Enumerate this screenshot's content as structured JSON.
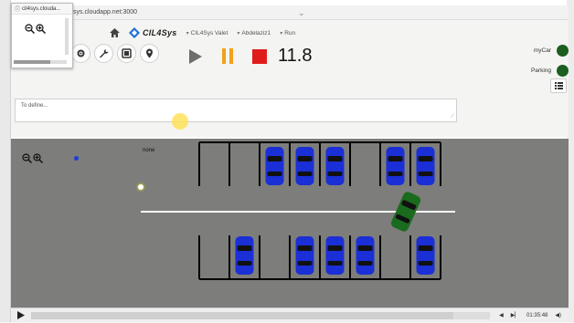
{
  "browser": {
    "tab_title": "cil4sys.clouda...",
    "url": "sys.cloudapp.net:3000"
  },
  "nav": {
    "logo_text": "CIL4Sys",
    "items": [
      {
        "label": "CIL4Sys Valet"
      },
      {
        "label": "Abdelaziz1"
      },
      {
        "label": "Run"
      }
    ]
  },
  "toolbar": {
    "icons": [
      "gear-icon",
      "wrench-icon",
      "film-icon",
      "map-pin-icon"
    ]
  },
  "playback": {
    "time": "11.8"
  },
  "status": {
    "items": [
      {
        "label": "myCar",
        "color": "#1b5e20"
      },
      {
        "label": "Parking",
        "color": "#1b5e20"
      }
    ]
  },
  "define": {
    "placeholder": "To define..."
  },
  "scene": {
    "label": "none",
    "parking_top": [
      false,
      false,
      true,
      true,
      true,
      false,
      true,
      true
    ],
    "parking_bottom": [
      false,
      true,
      false,
      true,
      true,
      true,
      false,
      true
    ],
    "car_color_parked": "#1a2fd6",
    "car_color_ego": "#1b6b1f",
    "ground_color": "#7d7d7b"
  },
  "video": {
    "time": "01:35:48"
  }
}
